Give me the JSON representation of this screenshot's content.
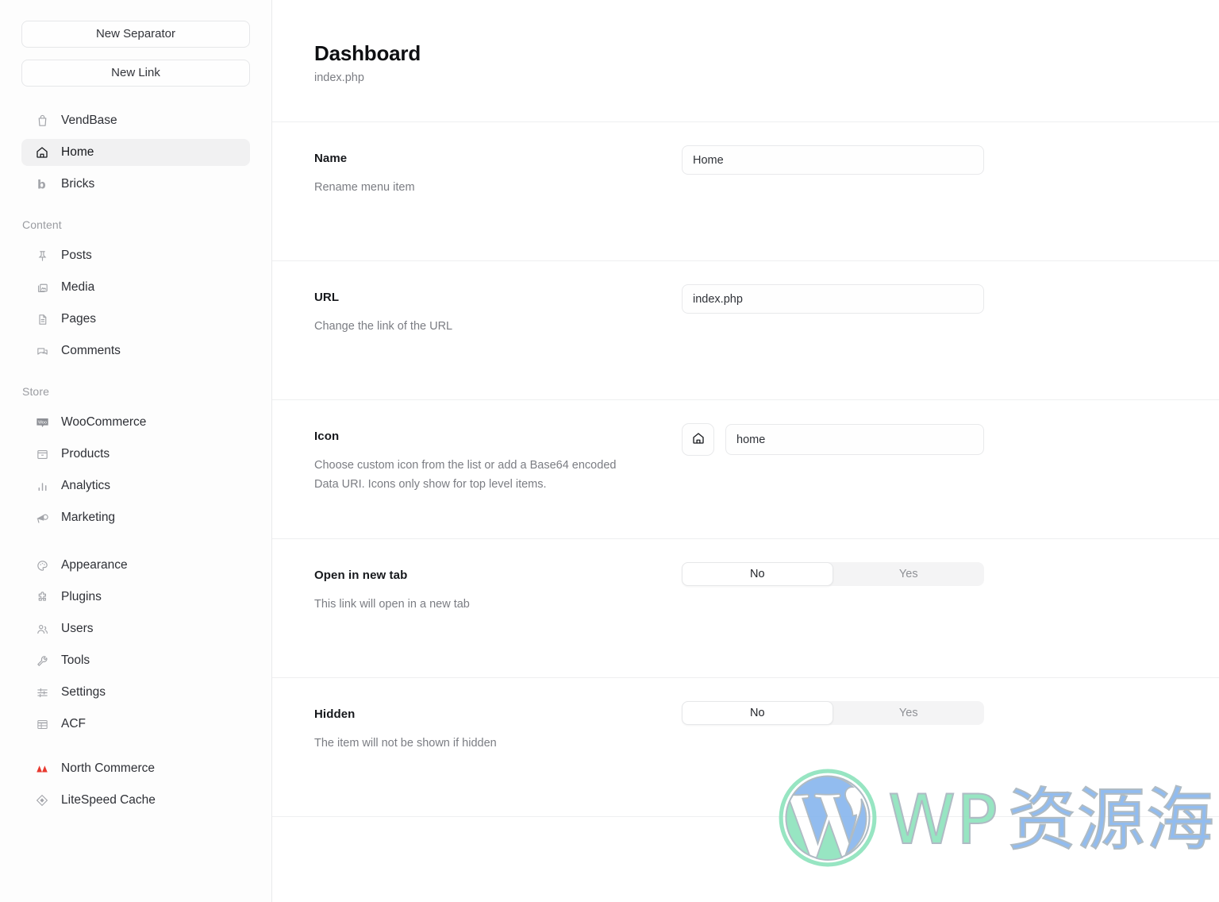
{
  "sidebar": {
    "buttons": [
      {
        "label": "New Separator",
        "name": "new-separator-button"
      },
      {
        "label": "New Link",
        "name": "new-link-button"
      }
    ],
    "top_items": [
      {
        "label": "VendBase",
        "icon": "shopping-bag-icon",
        "active": false
      },
      {
        "label": "Home",
        "icon": "home-icon",
        "active": true
      },
      {
        "label": "Bricks",
        "icon": "bricks-b-icon",
        "active": false
      }
    ],
    "content_heading": "Content",
    "content_items": [
      {
        "label": "Posts",
        "icon": "pin-icon"
      },
      {
        "label": "Media",
        "icon": "media-image-icon"
      },
      {
        "label": "Pages",
        "icon": "document-icon"
      },
      {
        "label": "Comments",
        "icon": "comment-bubble-icon"
      }
    ],
    "store_heading": "Store",
    "store_items": [
      {
        "label": "WooCommerce",
        "icon": "woo-badge-icon"
      },
      {
        "label": "Products",
        "icon": "archive-box-icon"
      },
      {
        "label": "Analytics",
        "icon": "bar-chart-icon"
      },
      {
        "label": "Marketing",
        "icon": "megaphone-icon"
      }
    ],
    "admin_items": [
      {
        "label": "Appearance",
        "icon": "palette-icon"
      },
      {
        "label": "Plugins",
        "icon": "puzzle-piece-icon"
      },
      {
        "label": "Users",
        "icon": "users-icon"
      },
      {
        "label": "Tools",
        "icon": "wrench-icon"
      },
      {
        "label": "Settings",
        "icon": "sliders-icon"
      },
      {
        "label": "ACF",
        "icon": "acf-grid-icon"
      }
    ],
    "plugin_items": [
      {
        "label": "North Commerce",
        "icon": "north-commerce-mountains-icon",
        "color": "#e8392f"
      },
      {
        "label": "LiteSpeed Cache",
        "icon": "litespeed-diamond-icon",
        "color": "#9a9ca1"
      }
    ]
  },
  "page": {
    "title": "Dashboard",
    "subtitle": "index.php"
  },
  "fields": {
    "name": {
      "label": "Name",
      "description": "Rename menu item",
      "value": "Home",
      "placeholder": "Name"
    },
    "url": {
      "label": "URL",
      "description": "Change the link of the URL",
      "value": "index.php",
      "placeholder": "URL"
    },
    "icon": {
      "label": "Icon",
      "description": "Choose custom icon from the list or add a Base64 encoded Data URI. Icons only show for top level items.",
      "value": "home",
      "placeholder": "Icon",
      "preview_icon": "home-icon"
    },
    "open_in_new_tab": {
      "label": "Open in new tab",
      "description": "This link will open in a new tab",
      "options": [
        "No",
        "Yes"
      ],
      "selected": "No"
    },
    "hidden": {
      "label": "Hidden",
      "description": "The item will not be shown if hidden",
      "options": [
        "No",
        "Yes"
      ],
      "selected": "No"
    }
  },
  "watermark": {
    "logo": "wordpress-logo",
    "text_latin": "WP",
    "text_cjk": "资源海",
    "color_green": "#8fe3bd",
    "color_blue": "#89b7ee"
  }
}
